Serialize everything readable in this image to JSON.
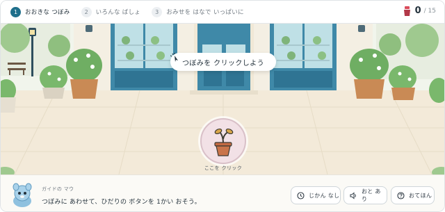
{
  "steps": [
    {
      "num": "1",
      "label": "おおきな つぼみ"
    },
    {
      "num": "2",
      "label": "いろんな ばしょ"
    },
    {
      "num": "3",
      "label": "おみせを はなで いっぱいに"
    }
  ],
  "counter": {
    "value": "0",
    "total": "/ 15",
    "icon": "flower-pot-counter-icon"
  },
  "scene": {
    "hint": "つぼみを クリックしよう",
    "hint_icon": "sparkle-cursor-icon",
    "pot_caption": "ここを クリック",
    "pot_icon": "sprout-pot-icon"
  },
  "guide": {
    "speaker": "ガイドの マウ",
    "message": "つぼみに あわせて、ひだりの ボタンを 1かい おそう。",
    "buttons": [
      {
        "label": "じかん なし",
        "icon": "clock-icon"
      },
      {
        "label": "おと あり",
        "icon": "speaker-icon"
      },
      {
        "label": "おてほん",
        "icon": "question-icon"
      }
    ]
  },
  "colors": {
    "accent": "#1f6f8b",
    "door": "#3f89a8",
    "pot_button_bg": "#f2e1e6"
  }
}
